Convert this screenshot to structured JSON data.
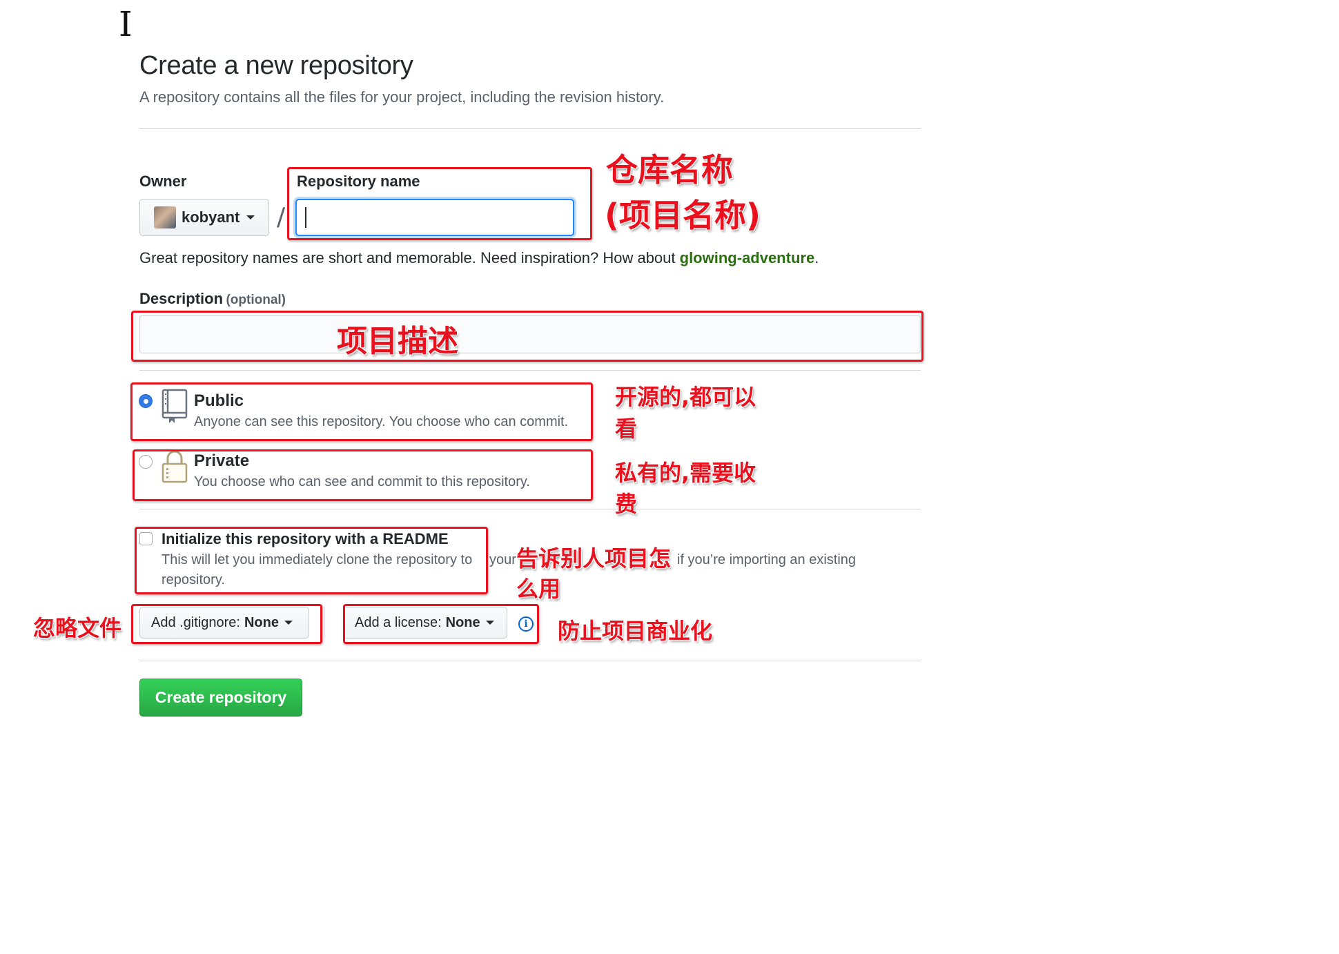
{
  "page": {
    "title": "Create a new repository",
    "subtitle": "A repository contains all the files for your project, including the revision history."
  },
  "owner": {
    "label": "Owner",
    "value": "kobyant"
  },
  "repo_name": {
    "label": "Repository name",
    "value": ""
  },
  "separator": "/",
  "name_hint": {
    "text": "Great repository names are short and memorable. Need inspiration? How about ",
    "suggestion": "glowing-adventure",
    "end": "."
  },
  "description": {
    "label": "Description",
    "optional": "(optional)",
    "value": ""
  },
  "visibility": {
    "public": {
      "title": "Public",
      "desc": "Anyone can see this repository. You choose who can commit.",
      "selected": true
    },
    "private": {
      "title": "Private",
      "desc": "You choose who can see and commit to this repository.",
      "selected": false
    }
  },
  "readme": {
    "title": "Initialize this repository with a README",
    "desc_line1": "This will let you immediately clone the repository to",
    "desc_line1_tail": "your",
    "desc_line1_after": "if you’re importing an existing",
    "desc_line2": "repository.",
    "checked": false
  },
  "gitignore": {
    "label": "Add .gitignore:",
    "value": "None"
  },
  "license": {
    "label": "Add a license:",
    "value": "None"
  },
  "create_button": "Create repository",
  "annotations": {
    "repo_name_1": "仓库名称",
    "repo_name_2": "(项目名称)",
    "description": "项目描述",
    "public_1": "开源的,都可以",
    "public_2": "看",
    "private_1": "私有的,需要收",
    "private_2": "费",
    "readme_1": "告诉别人项目怎",
    "readme_2": "么用",
    "gitignore": "忽略文件",
    "license": "防止项目商业化"
  },
  "icons": {
    "public": "repo-book-icon",
    "private": "lock-icon",
    "info": "info-icon",
    "cursor": "text-cursor-icon"
  },
  "colors": {
    "accent_blue": "#2188ff",
    "create_green": "#28a745",
    "annotation_red": "#e8111d"
  }
}
